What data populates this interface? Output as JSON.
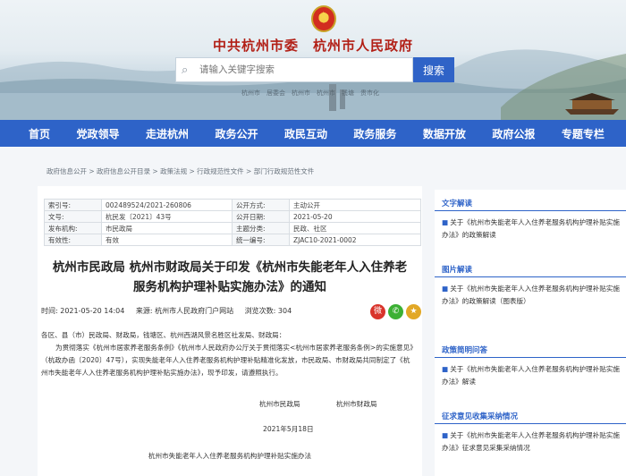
{
  "header": {
    "site_title": "中共杭州市委　杭州市人民政府",
    "search_placeholder": "请输入关键字搜索",
    "search_button": "搜索",
    "strip_text": "杭州市　居委会　杭州市　杭州市　钱塘　贵市化"
  },
  "nav": {
    "items": [
      "首页",
      "党政领导",
      "走进杭州",
      "政务公开",
      "政民互动",
      "政务服务",
      "数据开放",
      "政府公报",
      "专题专栏"
    ]
  },
  "breadcrumb": "政府信息公开 > 政府信息公开目录 > 政策法规 > 行政规范性文件 > 部门行政规范性文件",
  "info": {
    "rows": [
      {
        "k1": "索引号:",
        "v1": "002489524/2021-260806",
        "k2": "公开方式:",
        "v2": "主动公开"
      },
      {
        "k1": "文号:",
        "v1": "杭民发〔2021〕43号",
        "k2": "公开日期:",
        "v2": "2021-05-20"
      },
      {
        "k1": "发布机构:",
        "v1": "市民政局",
        "k2": "主题分类:",
        "v2": "民政、社区"
      },
      {
        "k1": "有效性:",
        "v1": "有效",
        "k2": "统一编号:",
        "v2": "ZJAC10-2021-0002"
      }
    ]
  },
  "doc": {
    "title_line1": "杭州市民政局 杭州市财政局关于印发《杭州市失能老年人入住养老",
    "title_line2": "服务机构护理补贴实施办法》的通知",
    "time": "时间: 2021-05-20 14:04",
    "source": "来源: 杭州市人民政府门户网站",
    "views": "浏览次数: 304",
    "recipients": "各区、县（市）民政局、财政局，钱塘区、杭州西湖风景名胜区社发局、财政局：",
    "paragraph": "为贯彻落实《杭州市居家养老服务条例》《杭州市人民政府办公厅关于贯彻落实<杭州市居家养老服务条例>的实施意见》（杭政办函〔2020〕47号），实现失能老年人入住养老服务机构护理补贴精准化发放，市民政局、市财政局共同制定了《杭州市失能老年人入住养老服务机构护理补贴实施办法》，现予印发，请遵照执行。",
    "signer1": "杭州市民政局",
    "signer2": "杭州市财政局",
    "date": "2021年5月18日",
    "attachment_title": "杭州市失能老年人入住养老服务机构护理补贴实施办法"
  },
  "sidebar": {
    "blocks": [
      {
        "head": "文字解读",
        "text": "关于《杭州市失能老年人入住养老服务机构护理补贴实施办法》的政策解读"
      },
      {
        "head": "图片解读",
        "text": "关于《杭州市失能老年人入住养老服务机构护理补贴实施办法》的政策解读（图表版）"
      },
      {
        "head": "政策简明问答",
        "text": "关于《杭州市失能老年人入住养老服务机构护理补贴实施办法》解读"
      },
      {
        "head": "征求意见收集采纳情况",
        "text": "关于《杭州市失能老年人入住养老服务机构护理补贴实施办法》征求意见采集采纳情况"
      }
    ]
  },
  "colors": {
    "nav": "#2e63c8",
    "title_red": "#b21f16"
  }
}
